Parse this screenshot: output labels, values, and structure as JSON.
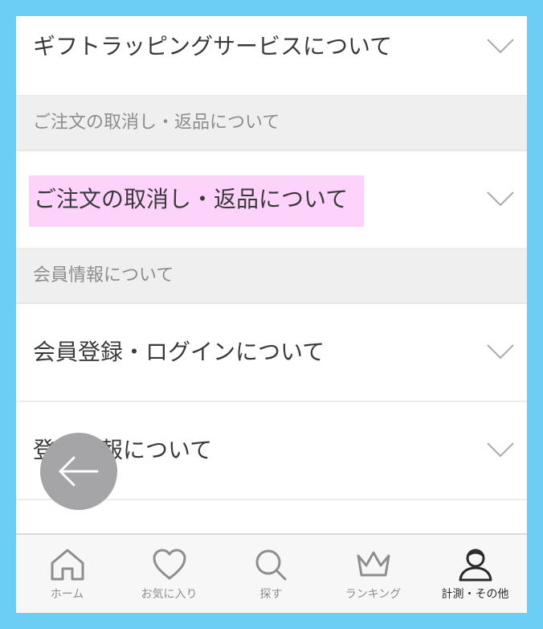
{
  "faq": {
    "gift_wrapping": "ギフトラッピングサービスについて",
    "cancel_return_section": "ご注文の取消し・返品について",
    "cancel_return_item": "ご注文の取消し・返品について",
    "member_section": "会員情報について",
    "member_login": "会員登録・ログインについて",
    "registered_info": "登録情報について"
  },
  "tabbar": {
    "home": "ホーム",
    "favorites": "お気に入り",
    "search": "探す",
    "ranking": "ランキング",
    "other": "計測・その他",
    "active_tab": "other"
  },
  "colors": {
    "background": "#6ccdf5",
    "highlight": "#fdd3fb",
    "fab": "#a5a5a7"
  },
  "icons": [
    "chevron-down-icon",
    "arrow-left-icon",
    "home-icon",
    "heart-icon",
    "search-icon",
    "crown-icon",
    "user-icon"
  ]
}
